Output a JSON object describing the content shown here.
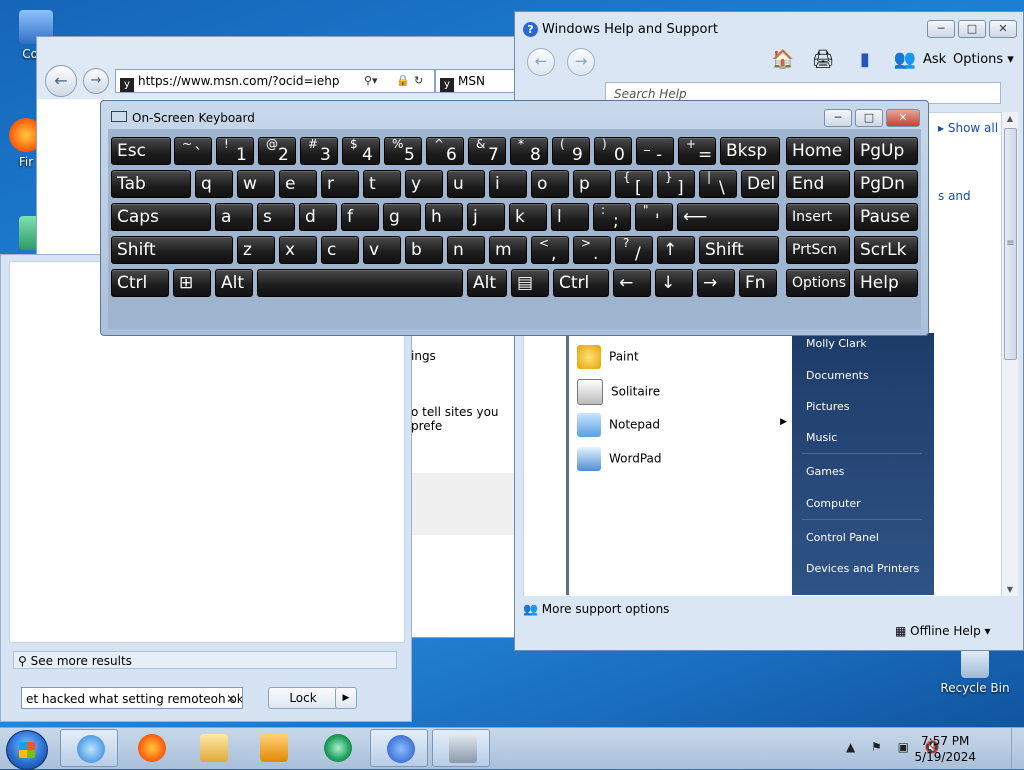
{
  "desktop": {
    "icons": [
      {
        "label": "Com",
        "name": "computer"
      },
      {
        "label": "Fir",
        "name": "firefox"
      },
      {
        "label": "Recycle Bin",
        "name": "recycle-bin"
      }
    ]
  },
  "ie": {
    "url": "https://www.msn.com/?ocid=iehp",
    "tab_title": "MSN",
    "text_settings": "ings",
    "text_tell": "o tell sites you prefe"
  },
  "help": {
    "title": "Windows Help and Support",
    "ask": "Ask",
    "options": "Options",
    "search_placeholder": "Search Help",
    "show_all": "Show all",
    "side_text": "s and",
    "more_support": "More support options",
    "offline_help": "Offline Help",
    "start_menu": {
      "left_items": [
        "Paint",
        "Solitaire",
        "Notepad",
        "WordPad"
      ],
      "right_items": [
        "Molly Clark",
        "Documents",
        "Pictures",
        "Music",
        "Games",
        "Computer",
        "Control Panel",
        "Devices and Printers"
      ]
    }
  },
  "search_panel": {
    "see_more": "See more results",
    "query": "et hacked what setting remoteoh ok",
    "lock_label": "Lock"
  },
  "osk": {
    "title": "On-Screen Keyboard",
    "rows": [
      [
        {
          "m": "Esc"
        },
        {
          "t": "~",
          "b": "`"
        },
        {
          "t": "!",
          "b": "1"
        },
        {
          "t": "@",
          "b": "2"
        },
        {
          "t": "#",
          "b": "3"
        },
        {
          "t": "$",
          "b": "4"
        },
        {
          "t": "%",
          "b": "5"
        },
        {
          "t": "^",
          "b": "6"
        },
        {
          "t": "&",
          "b": "7"
        },
        {
          "t": "*",
          "b": "8"
        },
        {
          "t": "(",
          "b": "9"
        },
        {
          "t": ")",
          "b": "0"
        },
        {
          "t": "_",
          "b": "-"
        },
        {
          "t": "+",
          "b": "="
        },
        {
          "m": "Bksp"
        },
        {
          "m": "Home"
        },
        {
          "m": "PgUp"
        }
      ],
      [
        {
          "m": "Tab"
        },
        {
          "m": "q"
        },
        {
          "m": "w"
        },
        {
          "m": "e"
        },
        {
          "m": "r"
        },
        {
          "m": "t"
        },
        {
          "m": "y"
        },
        {
          "m": "u"
        },
        {
          "m": "i"
        },
        {
          "m": "o"
        },
        {
          "m": "p"
        },
        {
          "t": "{",
          "b": "["
        },
        {
          "t": "}",
          "b": "]"
        },
        {
          "t": "|",
          "b": "\\"
        },
        {
          "m": "Del"
        },
        {
          "m": "End"
        },
        {
          "m": "PgDn"
        }
      ],
      [
        {
          "m": "Caps"
        },
        {
          "m": "a"
        },
        {
          "m": "s"
        },
        {
          "m": "d"
        },
        {
          "m": "f"
        },
        {
          "m": "g"
        },
        {
          "m": "h"
        },
        {
          "m": "j"
        },
        {
          "m": "k"
        },
        {
          "m": "l"
        },
        {
          "t": ":",
          "b": ";"
        },
        {
          "t": "\"",
          "b": "'"
        },
        {
          "m": "⟵"
        },
        {
          "m": "Insert"
        },
        {
          "m": "Pause"
        }
      ],
      [
        {
          "m": "Shift"
        },
        {
          "m": "z"
        },
        {
          "m": "x"
        },
        {
          "m": "c"
        },
        {
          "m": "v"
        },
        {
          "m": "b"
        },
        {
          "m": "n"
        },
        {
          "m": "m"
        },
        {
          "t": "<",
          "b": ","
        },
        {
          "t": ">",
          "b": "."
        },
        {
          "t": "?",
          "b": "/"
        },
        {
          "m": "↑"
        },
        {
          "m": "Shift"
        },
        {
          "m": "PrtScn"
        },
        {
          "m": "ScrLk"
        }
      ],
      [
        {
          "m": "Ctrl"
        },
        {
          "m": "⊞"
        },
        {
          "m": "Alt"
        },
        {
          "m": ""
        },
        {
          "m": "Alt"
        },
        {
          "m": "▤"
        },
        {
          "m": "Ctrl"
        },
        {
          "m": "←"
        },
        {
          "m": "↓"
        },
        {
          "m": "→"
        },
        {
          "m": "Fn"
        },
        {
          "m": "Options"
        },
        {
          "m": "Help"
        }
      ]
    ]
  },
  "taskbar": {
    "time": "7:57 PM",
    "date": "5/19/2024",
    "apps": [
      "internet-explorer",
      "firefox",
      "file-explorer",
      "media-player",
      "remote-assistance",
      "help",
      "printer"
    ]
  },
  "colors": {
    "desktop_blue": "#1f82d6",
    "key_black": "#1c1c1c",
    "link_blue": "#1a4fa8"
  }
}
